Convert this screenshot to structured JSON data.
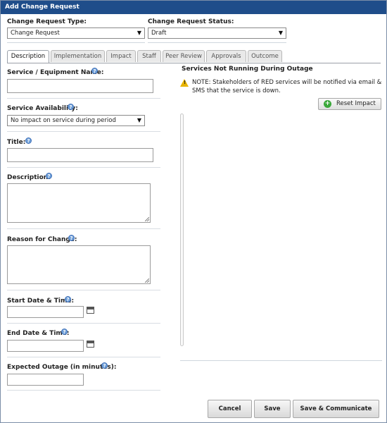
{
  "window": {
    "title": "Add Change Request"
  },
  "header": {
    "type_label": "Change Request Type:",
    "type_value": "Change Request",
    "status_label": "Change Request Status:",
    "status_value": "Draft"
  },
  "tabs": [
    {
      "label": "Description",
      "active": true
    },
    {
      "label": "Implementation",
      "active": false
    },
    {
      "label": "Impact",
      "active": false
    },
    {
      "label": "Staff",
      "active": false
    },
    {
      "label": "Peer Review",
      "active": false
    },
    {
      "label": "Approvals",
      "active": false
    },
    {
      "label": "Outcome",
      "active": false
    }
  ],
  "form": {
    "service_label": "Service / Equipment Name:",
    "service_value": "",
    "availability_label": "Service Availability:",
    "availability_value": "No impact on service during period",
    "title_label": "Title:",
    "title_value": "",
    "description_label": "Description:",
    "reason_label": "Reason for Change:",
    "start_label": "Start Date & Time:",
    "end_label": "End Date & Time:",
    "outage_label": "Expected Outage (in minutes):"
  },
  "impact": {
    "heading": "Services Not Running During Outage",
    "note": "NOTE: Stakeholders of RED services will be notified via email & SMS that the service is down.",
    "reset_label": "Reset Impact"
  },
  "footer": {
    "cancel_label": "Cancel",
    "save_label": "Save",
    "save_communicate_label": "Save & Communicate"
  },
  "colors": {
    "titlebar": "#1f4d8a",
    "help_icon": "#6f9fd8",
    "warning": "#e8b400",
    "add_icon": "#3aa83a"
  }
}
